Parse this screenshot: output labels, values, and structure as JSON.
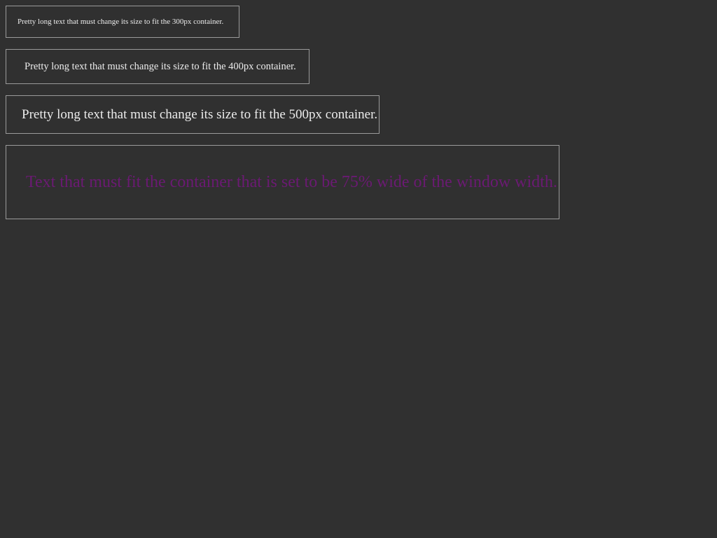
{
  "containers": [
    {
      "text": "Pretty long text that must change its size to fit the 300px container."
    },
    {
      "text": "Pretty long text that must change its size to fit the 400px container."
    },
    {
      "text": "Pretty long text that must change its size to fit the 500px container."
    },
    {
      "text": "Text that must fit the container that is set to be 75% wide of the window width."
    }
  ],
  "colors": {
    "background": "#303030",
    "border": "#9a9a9a",
    "text": "#ececec",
    "accent_text": "#6b1a73"
  }
}
